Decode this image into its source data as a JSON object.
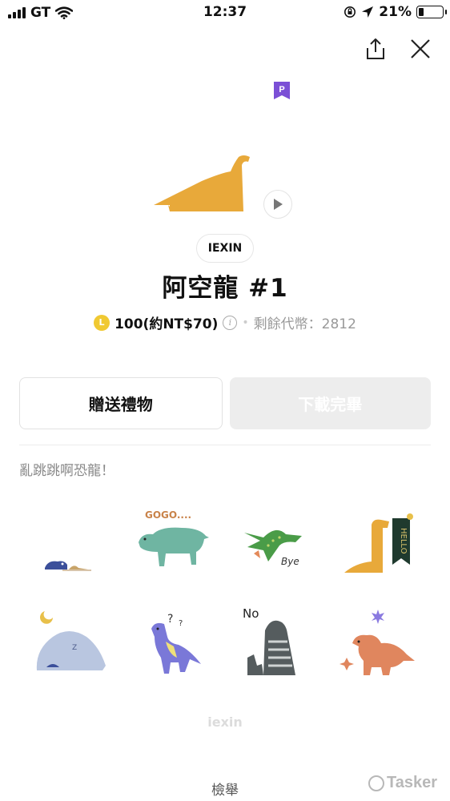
{
  "status": {
    "carrier": "GT",
    "time": "12:37",
    "battery": "21%",
    "battery_level": 0.21
  },
  "actions": {
    "share_icon": "share-icon",
    "close_icon": "close-icon"
  },
  "badge": {
    "letter": "P",
    "color": "#7b4fd6"
  },
  "author": "IEXIN",
  "title": "阿空龍 #1",
  "price": {
    "coin_letter": "L",
    "amount": "100(約NT$70)",
    "info": "i",
    "separator": "•",
    "remaining": "剩餘代幣：2812"
  },
  "buttons": {
    "gift": "贈送禮物",
    "download": "下載完畢"
  },
  "description": "亂跳跳啊恐龍！",
  "stickers": [
    {
      "name": "sleeping-dino-sticker"
    },
    {
      "name": "gogo-dino-sticker",
      "caption": "GOGO...."
    },
    {
      "name": "flying-dino-bye-sticker",
      "caption": "Bye"
    },
    {
      "name": "hello-banner-dino-sticker",
      "caption": "HELLO"
    },
    {
      "name": "moon-sleep-dino-sticker",
      "caption": "Z"
    },
    {
      "name": "question-dino-sticker",
      "caption": "?"
    },
    {
      "name": "no-dino-sticker",
      "caption": "No"
    },
    {
      "name": "sparkle-dino-sticker"
    }
  ],
  "watermark": "iexin",
  "report": "檢舉",
  "tasker": "Tasker",
  "colors": {
    "accent_yellow": "#e8a93a",
    "coin": "#f0c932",
    "premium": "#7b4fd6"
  }
}
